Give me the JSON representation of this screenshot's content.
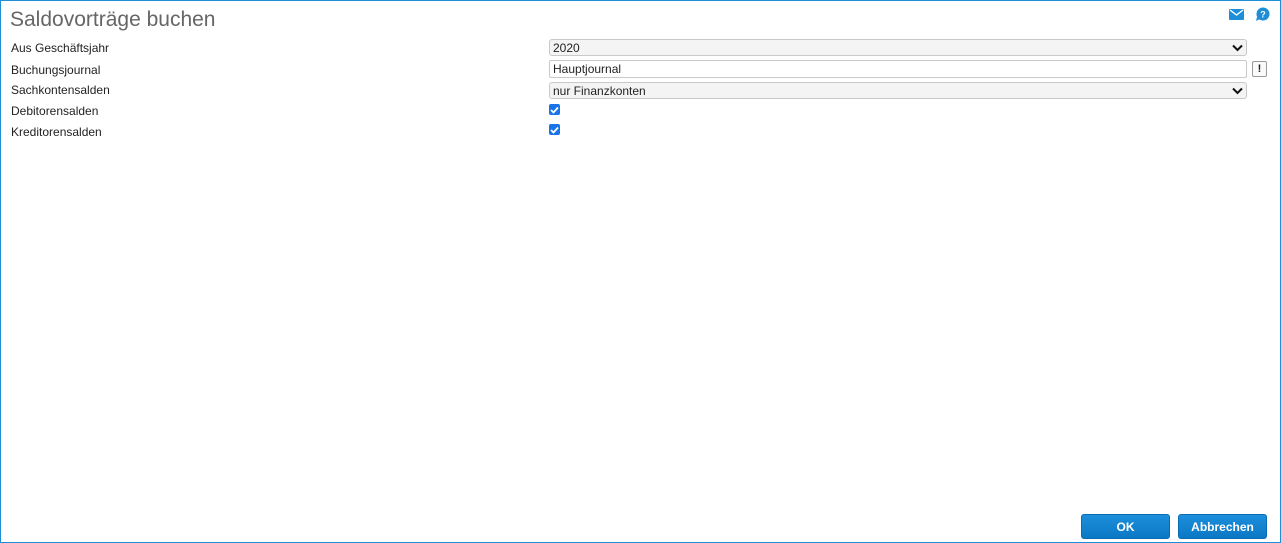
{
  "dialog": {
    "title": "Saldovorträge buchen"
  },
  "header_icons": {
    "mail": "mail-icon",
    "help": "help-icon"
  },
  "form": {
    "fiscal_year": {
      "label": "Aus Geschäftsjahr",
      "value": "2020"
    },
    "journal": {
      "label": "Buchungsjournal",
      "value": "Hauptjournal",
      "hint": "!"
    },
    "account_balances": {
      "label": "Sachkontensalden",
      "value": "nur Finanzkonten"
    },
    "debtor_balances": {
      "label": "Debitorensalden",
      "checked": true
    },
    "creditor_balances": {
      "label": "Kreditorensalden",
      "checked": true
    }
  },
  "buttons": {
    "ok": "OK",
    "cancel": "Abbrechen"
  },
  "colors": {
    "accent": "#1e8fd6",
    "checkbox": "#1a73e8"
  }
}
